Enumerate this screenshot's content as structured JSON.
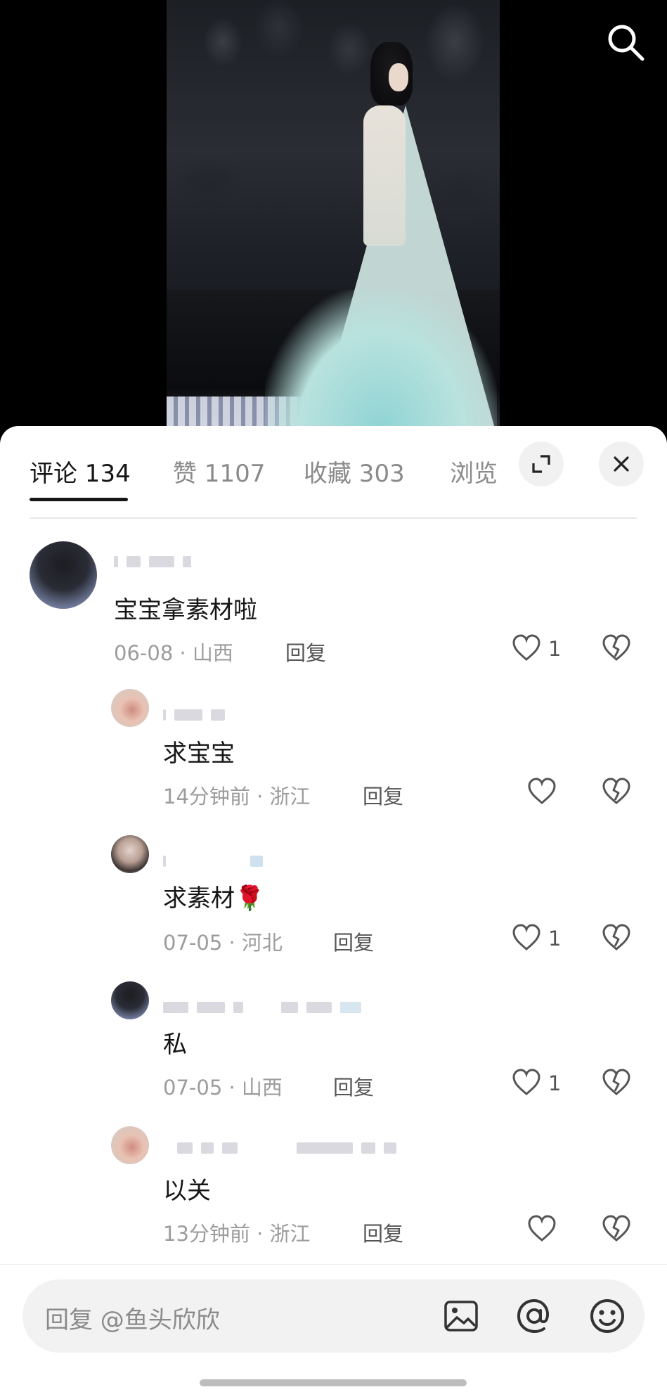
{
  "tabs": [
    {
      "label": "评论 134"
    },
    {
      "label": "赞 1107"
    },
    {
      "label": "收藏 303"
    },
    {
      "label": "浏览"
    }
  ],
  "comments": [
    {
      "text": "宝宝拿素材啦",
      "meta": "06-08 · 山西",
      "reply": "回复",
      "likes": "1"
    },
    {
      "text": "求宝宝",
      "meta": "14分钟前 · 浙江",
      "reply": "回复",
      "likes": ""
    },
    {
      "text": "求素材🌹",
      "meta": "07-05 · 河北",
      "reply": "回复",
      "likes": "1"
    },
    {
      "text": "私",
      "meta": "07-05 · 山西",
      "reply": "回复",
      "likes": "1"
    },
    {
      "text": "以关",
      "meta": "13分钟前 · 浙江",
      "reply": "回复",
      "likes": ""
    }
  ],
  "input": {
    "placeholder": "回复 @鱼头欣欣"
  },
  "icons": {
    "search": "search-icon",
    "expand": "expand-icon",
    "close": "close-icon",
    "like": "heart-outline-icon",
    "dislike": "broken-heart-icon",
    "image": "image-icon",
    "mention": "at-icon",
    "emoji": "emoji-icon"
  },
  "colors": {
    "sheet_bg": "#ffffff",
    "text": "#161616",
    "muted": "#9c9c9c",
    "accent_underline": "#161616"
  }
}
